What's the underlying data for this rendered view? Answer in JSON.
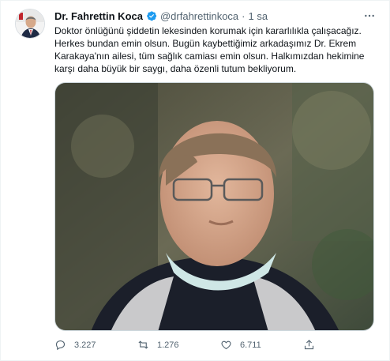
{
  "tweet": {
    "name": "Dr. Fahrettin Koca",
    "handle": "@drfahrettinkoca",
    "separator": "·",
    "time": "1 sa",
    "lines": [
      "Doktor önlüğünü şiddetin lekesinden korumak için kararlılıkla çalışacağız.",
      "Herkes bundan emin olsun. Bugün kaybettiğimiz arkadaşımız Dr. Ekrem",
      "Karakaya'nın ailesi, tüm sağlık camiası emin olsun. Halkımızdan hekimine",
      "karşı daha büyük bir saygı, daha özenli tutum bekliyorum."
    ]
  },
  "actions": {
    "replies": "3.227",
    "retweets": "1.276",
    "likes": "6.711"
  },
  "icons": {
    "verified": "verified-badge-icon",
    "more": "more-options-icon",
    "reply": "reply-icon",
    "retweet": "retweet-icon",
    "like": "like-icon",
    "share": "share-icon"
  },
  "colors": {
    "verified": "#1d9bf0",
    "secondary_text": "#536471",
    "primary_text": "#0f1419"
  }
}
